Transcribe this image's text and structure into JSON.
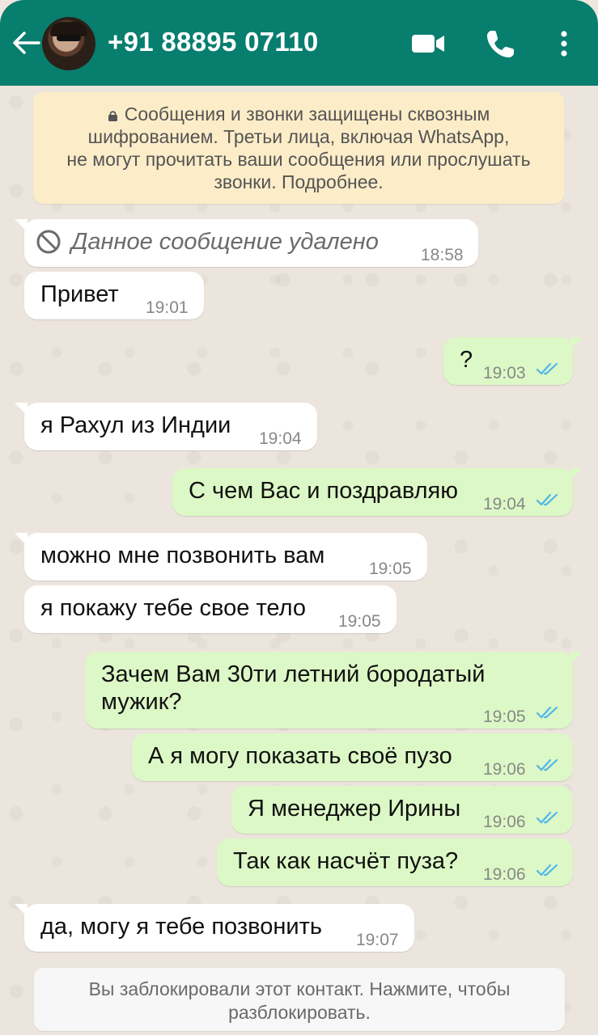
{
  "header": {
    "title": "+91 88895 07110",
    "bg_color": "#077e6e",
    "icons": [
      "back-arrow-icon",
      "video-call-icon",
      "phone-call-icon",
      "more-menu-icon"
    ]
  },
  "encryption_notice": {
    "line1": "Сообщения и звонки защищены сквозным",
    "line2": "шифрованием. Третьи лица, включая WhatsApp,",
    "line3": "не могут прочитать ваши сообщения или прослушать",
    "line4": "звонки. Подробнее."
  },
  "messages": [
    {
      "dir": "in",
      "text": "Данное сообщение удалено",
      "time": "18:58",
      "deleted": true
    },
    {
      "dir": "in",
      "text": "Привет",
      "time": "19:01"
    },
    {
      "dir": "out",
      "text": "?",
      "time": "19:03",
      "read": true
    },
    {
      "dir": "in",
      "text": "я Рахул из Индии",
      "time": "19:04"
    },
    {
      "dir": "out",
      "text": "С чем Вас и поздравляю",
      "time": "19:04",
      "read": true
    },
    {
      "dir": "in",
      "text": "можно мне позвонить вам",
      "time": "19:05"
    },
    {
      "dir": "in",
      "text": "я покажу тебе свое тело",
      "time": "19:05"
    },
    {
      "dir": "out",
      "text_line1": "Зачем Вам 30ти летний бородатый",
      "text_line2": "мужик?",
      "time": "19:05",
      "read": true
    },
    {
      "dir": "out",
      "text": "А я могу показать своё пузо",
      "time": "19:06",
      "read": true
    },
    {
      "dir": "out",
      "text": "Я менеджер Ирины",
      "time": "19:06",
      "read": true
    },
    {
      "dir": "out",
      "text": "Так как насчёт пуза?",
      "time": "19:06",
      "read": true
    },
    {
      "dir": "in",
      "text": "да, могу я тебе позвонить",
      "time": "19:07"
    }
  ],
  "blocked_banner": {
    "line1": "Вы заблокировали этот контакт. Нажмите, чтобы",
    "line2": "разблокировать."
  },
  "colors": {
    "incoming_bubble": "#ffffff",
    "outgoing_bubble": "#dcf8c6",
    "read_ticks": "#4fb6ec",
    "notice_bg": "#fcedc8"
  }
}
